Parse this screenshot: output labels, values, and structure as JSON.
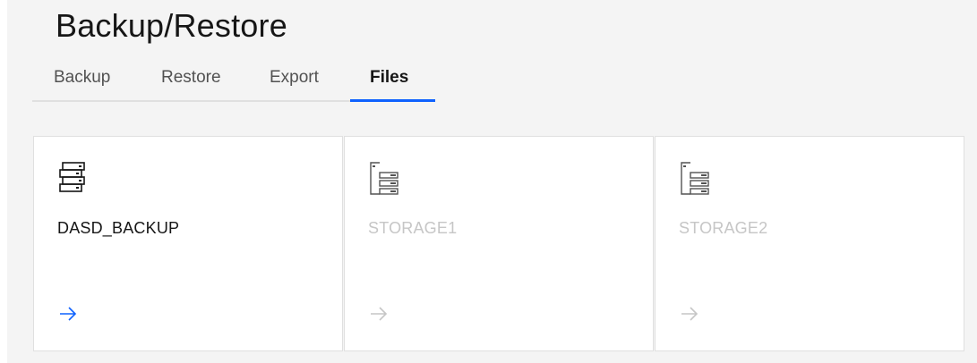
{
  "page": {
    "title": "Backup/Restore"
  },
  "tabs": [
    {
      "label": "Backup",
      "active": false
    },
    {
      "label": "Restore",
      "active": false
    },
    {
      "label": "Export",
      "active": false
    },
    {
      "label": "Files",
      "active": true
    }
  ],
  "tiles": [
    {
      "label": "DASD_BACKUP",
      "icon": "server-stack-icon",
      "enabled": true
    },
    {
      "label": "STORAGE1",
      "icon": "storage-rack-icon",
      "enabled": false
    },
    {
      "label": "STORAGE2",
      "icon": "storage-rack-icon",
      "enabled": false
    }
  ],
  "colors": {
    "accent": "#0f62fe",
    "disabled": "#c6c6c6",
    "text": "#161616",
    "background": "#f4f4f4"
  }
}
